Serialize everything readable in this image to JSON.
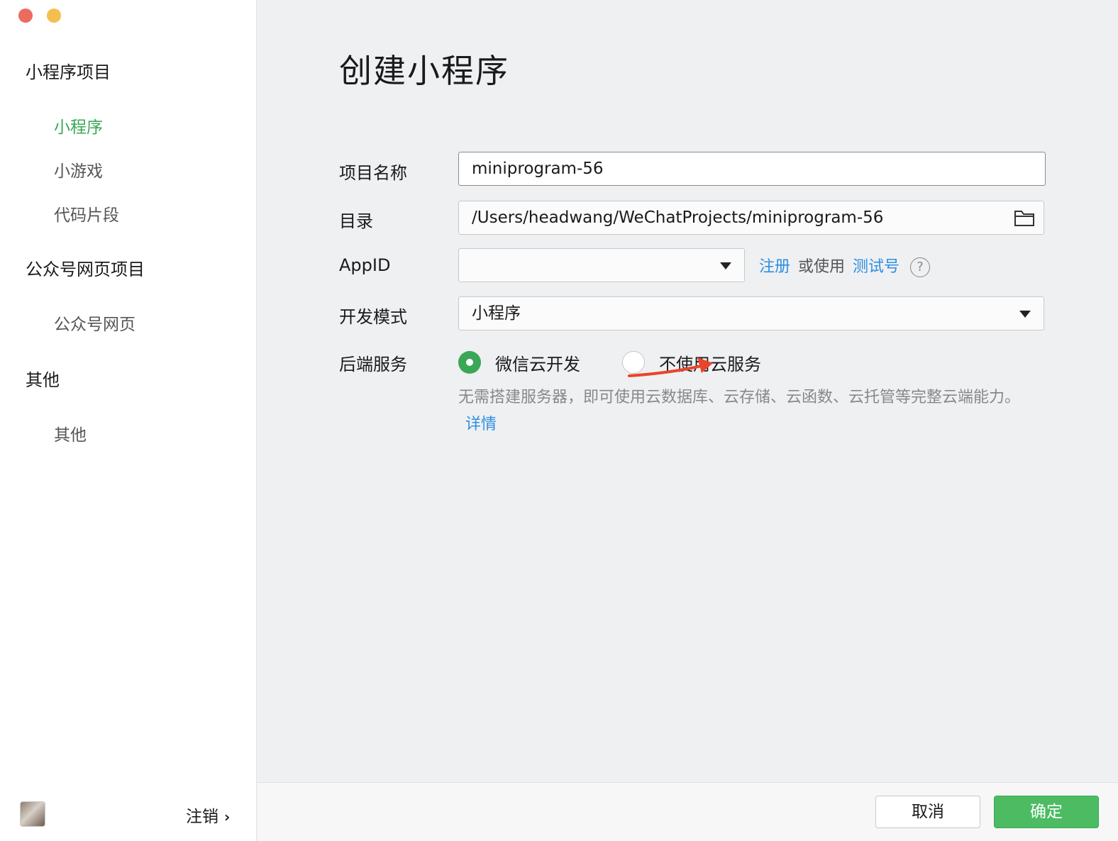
{
  "sidebar": {
    "groups": [
      {
        "label": "小程序项目",
        "items": [
          {
            "label": "小程序",
            "active": true
          },
          {
            "label": "小游戏"
          },
          {
            "label": "代码片段"
          }
        ]
      },
      {
        "label": "公众号网页项目",
        "items": [
          {
            "label": "公众号网页"
          }
        ]
      },
      {
        "label": "其他",
        "items": [
          {
            "label": "其他"
          }
        ]
      }
    ],
    "logout_label": "注销"
  },
  "page": {
    "title": "创建小程序"
  },
  "form": {
    "project_name": {
      "label": "项目名称",
      "value": "miniprogram-56"
    },
    "directory": {
      "label": "目录",
      "value": "/Users/headwang/WeChatProjects/miniprogram-56"
    },
    "appid": {
      "label": "AppID",
      "value": "",
      "register_link": "注册",
      "or_use": "或使用",
      "test_link": "测试号",
      "help": "?"
    },
    "dev_mode": {
      "label": "开发模式",
      "value": "小程序"
    },
    "backend": {
      "label": "后端服务",
      "options": [
        {
          "label": "微信云开发",
          "selected": true
        },
        {
          "label": "不使用云服务",
          "selected": false
        }
      ],
      "description": "无需搭建服务器，即可使用云数据库、云存储、云函数、云托管等完整云端能力。",
      "details_link": "详情"
    }
  },
  "footer": {
    "cancel_label": "取消",
    "ok_label": "确定"
  },
  "colors": {
    "accent_green": "#3aa757",
    "link_blue": "#2e8fe0",
    "arrow_red": "#e8452c"
  }
}
